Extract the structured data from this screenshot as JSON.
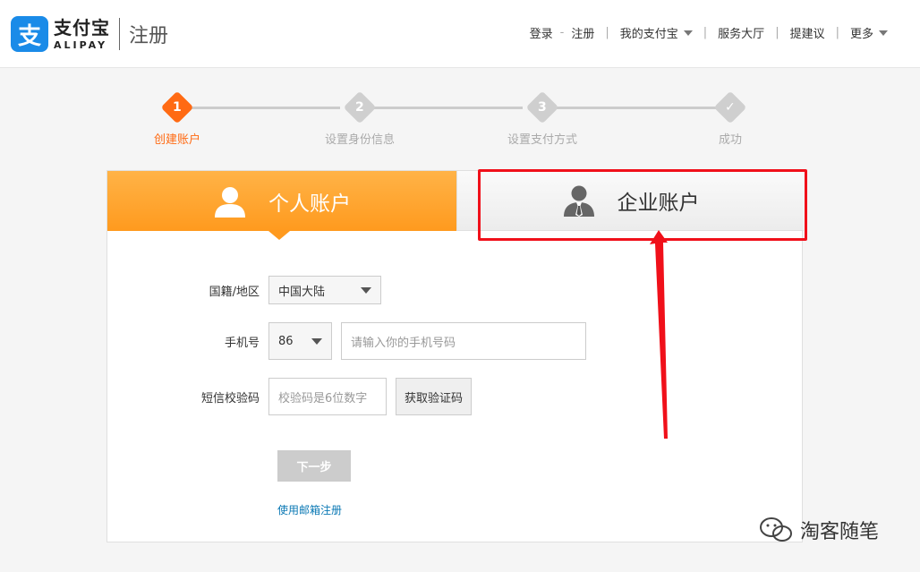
{
  "header": {
    "logo_glyph": "支",
    "logo_cn": "支付宝",
    "logo_en": "ALIPAY",
    "page_title": "注册",
    "nav": {
      "login": "登录",
      "dash": "-",
      "register": "注册",
      "my_alipay": "我的支付宝",
      "service": "服务大厅",
      "feedback": "提建议",
      "more": "更多"
    },
    "colors": {
      "brand": "#1a8be8"
    }
  },
  "steps": [
    {
      "num": "1",
      "label": "创建账户",
      "active": true
    },
    {
      "num": "2",
      "label": "设置身份信息",
      "active": false
    },
    {
      "num": "3",
      "label": "设置支付方式",
      "active": false
    },
    {
      "num": "✓",
      "label": "成功",
      "active": false
    }
  ],
  "tabs": {
    "personal": "个人账户",
    "business": "企业账户"
  },
  "form": {
    "region_label": "国籍/地区",
    "region_value": "中国大陆",
    "phone_label": "手机号",
    "phone_code": "86",
    "phone_placeholder": "请输入你的手机号码",
    "sms_label": "短信校验码",
    "sms_placeholder": "校验码是6位数字",
    "get_code": "获取验证码",
    "next": "下一步",
    "email_register": "使用邮箱注册"
  },
  "watermark": "淘客随笔"
}
